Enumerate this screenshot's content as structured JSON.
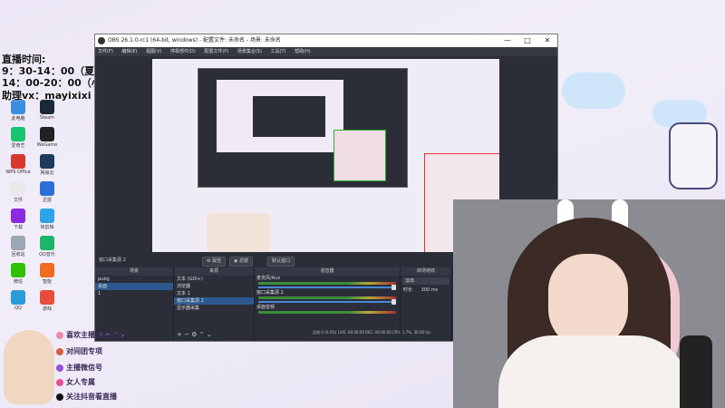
{
  "desktop": {
    "icons": [
      {
        "label": "此电脑",
        "color": "#3a8de0"
      },
      {
        "label": "Steam",
        "color": "#1b2838"
      },
      {
        "label": "爱奇艺",
        "color": "#19c36f"
      },
      {
        "label": "WeGame",
        "color": "#222222"
      },
      {
        "label": "WPS Office",
        "color": "#d8382c"
      },
      {
        "label": "网易云",
        "color": "#1f3b5c"
      },
      {
        "label": "文件",
        "color": "#e9e9e9"
      },
      {
        "label": "迅雷",
        "color": "#2a6fd8"
      },
      {
        "label": "下载",
        "color": "#8a2be2"
      },
      {
        "label": "快剪辑",
        "color": "#2da3e8"
      },
      {
        "label": "回收站",
        "color": "#9aa7b5"
      },
      {
        "label": "QQ音乐",
        "color": "#1bb66a"
      },
      {
        "label": "微信",
        "color": "#2dc100"
      },
      {
        "label": "智能",
        "color": "#f06c1e"
      },
      {
        "label": "QQ",
        "color": "#2a9bd8"
      },
      {
        "label": "游戏",
        "color": "#e84c3d"
      }
    ]
  },
  "overlay": {
    "line1": "直播时间:",
    "line2": "9：30-14：00（夏天）",
    "line3": "14：00-20：00（小蕴）",
    "line4": "助理vx：mayixixi"
  },
  "obs": {
    "title": "OBS 26.1.0-rc1 (64-bit, windows) - 配置文件: 未命名 - 场景: 未命名",
    "menu": [
      "文件(F)",
      "编辑(E)",
      "视图(V)",
      "停靠部件(D)",
      "配置文件(P)",
      "场景集合(S)",
      "工具(T)",
      "帮助(H)"
    ],
    "toolbar": {
      "capture_label": "窗口采集源 2",
      "properties": "属性",
      "filters": "滤镜",
      "default_window": "默认窗口"
    },
    "scenes": {
      "header": "场景",
      "items": [
        "pubg",
        "桌面",
        "1"
      ]
    },
    "sources": {
      "header": "来源",
      "items": [
        "文本 (GDI+)",
        "浏览器",
        "文本 1",
        "窗口采集源 2",
        "显示器采集"
      ]
    },
    "mixer": {
      "header": "混音器",
      "channels": [
        {
          "name": "麦克风/Aux",
          "db": "0.0 dB"
        },
        {
          "name": "窗口采集源 2",
          "db": "0.0 dB"
        },
        {
          "name": "桌面音频",
          "db": "0.0 dB"
        }
      ]
    },
    "transitions": {
      "header": "转场特效",
      "type": "淡出",
      "duration_label": "时长",
      "duration": "300 ms"
    },
    "status": "丢帧 0 (0.0%)   LIVE: 00:00:00   REC: 00:00:00   CPU: 1.7%, 30.00 fps"
  },
  "sticker": {
    "lines": [
      {
        "text": "喜欢主播来点关注",
        "color": "#e88aa8"
      },
      {
        "text": "对间团专项",
        "color": "#d86040"
      },
      {
        "text": "主播微信号",
        "color": "#9a4fd8"
      },
      {
        "text": "女人专属",
        "color": "#e84e9a"
      },
      {
        "text": "关注抖音看直播",
        "color": "#111111"
      }
    ]
  }
}
